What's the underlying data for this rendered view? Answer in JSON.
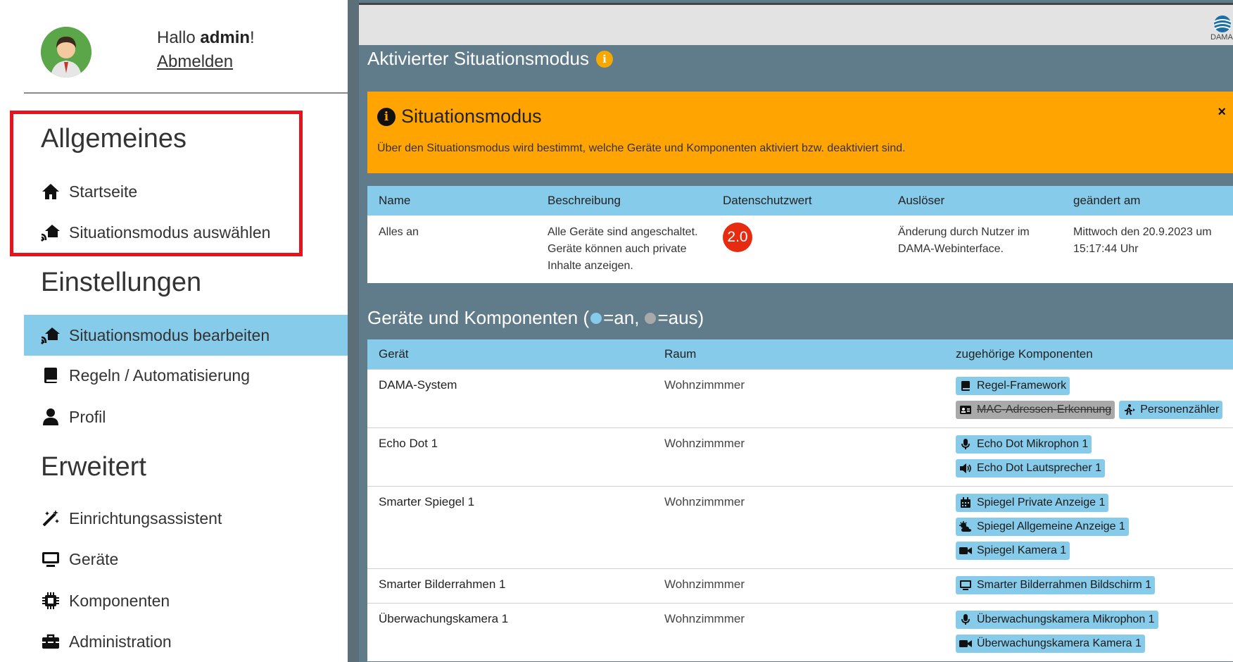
{
  "user": {
    "greeting_prefix": "Hallo ",
    "username": "admin",
    "greeting_suffix": "!",
    "logout_label": "Abmelden"
  },
  "sidebar": {
    "sections": [
      {
        "title": "Allgemeines",
        "items": [
          {
            "label": "Startseite",
            "icon": "home-icon"
          },
          {
            "label": "Situationsmodus auswählen",
            "icon": "house-wifi-icon"
          }
        ]
      },
      {
        "title": "Einstellungen",
        "items": [
          {
            "label": "Situationsmodus bearbeiten",
            "icon": "house-wifi-icon",
            "active": true
          },
          {
            "label": "Regeln / Automatisierung",
            "icon": "book-icon"
          },
          {
            "label": "Profil",
            "icon": "user-icon"
          }
        ]
      },
      {
        "title": "Erweitert",
        "items": [
          {
            "label": "Einrichtungsassistent",
            "icon": "magic-wand-icon"
          },
          {
            "label": "Geräte",
            "icon": "monitor-icon"
          },
          {
            "label": "Komponenten",
            "icon": "chip-icon"
          },
          {
            "label": "Administration",
            "icon": "toolbox-icon"
          }
        ]
      }
    ]
  },
  "header": {
    "logo_text": "DAMA"
  },
  "active_mode": {
    "title": "Aktivierter Situationsmodus",
    "alert": {
      "title": "Situationsmodus",
      "text": "Über den Situationsmodus wird bestimmt, welche Geräte und Komponenten aktiviert bzw. deaktiviert sind.",
      "close": "×"
    },
    "table": {
      "headers": [
        "Name",
        "Beschreibung",
        "Datenschutzwert",
        "Auslöser",
        "geändert am"
      ],
      "row": {
        "name": "Alles an",
        "description": "Alle Geräte sind angeschaltet. Geräte können auch private Inhalte anzeigen.",
        "privacy_value": "2.0",
        "trigger": "Änderung durch Nutzer im DAMA-Webinterface.",
        "changed_at": "Mittwoch den 20.9.2023 um 15:17:44 Uhr"
      }
    }
  },
  "devices": {
    "title_prefix": "Geräte und Komponenten (",
    "legend_on": "=an, ",
    "legend_off": "=aus)",
    "color_on": "#87cbea",
    "color_off": "#a9a9a9",
    "headers": [
      "Gerät",
      "Raum",
      "zugehörige Komponenten"
    ],
    "rows": [
      {
        "device": "DAMA-System",
        "room": "Wohnzimmmer",
        "component_rows": [
          [
            {
              "label": "Regel-Framework",
              "icon": "book-icon",
              "on": true
            }
          ],
          [
            {
              "label": "MAC-Adressen-Erkennung",
              "icon": "id-card-icon",
              "on": false
            },
            {
              "label": "Personenzähler",
              "icon": "running-person-icon",
              "on": true
            }
          ]
        ]
      },
      {
        "device": "Echo Dot 1",
        "room": "Wohnzimmmer",
        "component_rows": [
          [
            {
              "label": "Echo Dot Mikrophon 1",
              "icon": "microphone-icon",
              "on": true
            }
          ],
          [
            {
              "label": "Echo Dot Lautsprecher 1",
              "icon": "speaker-icon",
              "on": true
            }
          ]
        ]
      },
      {
        "device": "Smarter Spiegel 1",
        "room": "Wohnzimmmer",
        "component_rows": [
          [
            {
              "label": "Spiegel Private Anzeige 1",
              "icon": "calendar-icon",
              "on": true
            }
          ],
          [
            {
              "label": "Spiegel Allgemeine Anzeige 1",
              "icon": "weather-icon",
              "on": true
            }
          ],
          [
            {
              "label": "Spiegel Kamera 1",
              "icon": "video-camera-icon",
              "on": true
            }
          ]
        ]
      },
      {
        "device": "Smarter Bilderrahmen 1",
        "room": "Wohnzimmmer",
        "component_rows": [
          [
            {
              "label": "Smarter Bilderrahmen Bildschirm 1",
              "icon": "monitor-icon",
              "on": true
            }
          ]
        ]
      },
      {
        "device": "Überwachungskamera 1",
        "room": "Wohnzimmmer",
        "component_rows": [
          [
            {
              "label": "Überwachungskamera Mikrophon 1",
              "icon": "microphone-icon",
              "on": true
            }
          ],
          [
            {
              "label": "Überwachungskamera Kamera 1",
              "icon": "video-camera-icon",
              "on": true
            }
          ]
        ]
      }
    ]
  }
}
